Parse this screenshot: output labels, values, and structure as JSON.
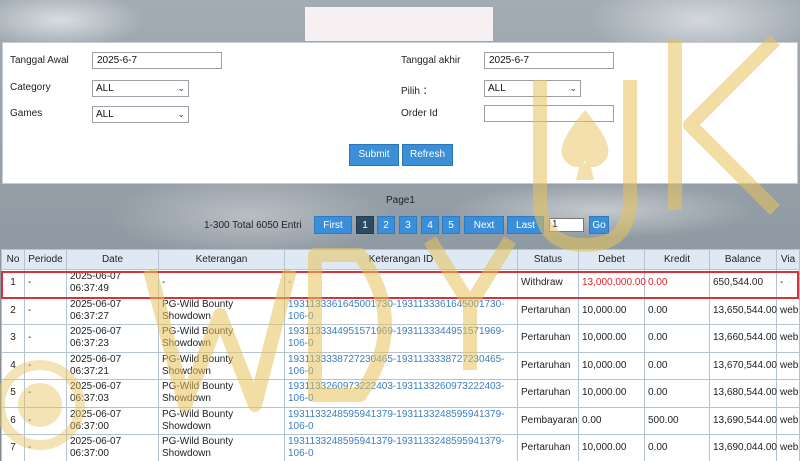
{
  "filters": {
    "tanggal_awal_label": "Tanggal Awal",
    "tanggal_awal_value": "2025-6-7",
    "tanggal_akhir_label": "Tanggal akhir",
    "tanggal_akhir_value": "2025-6-7",
    "category_label": "Category",
    "category_value": "ALL",
    "pilih_label": "Pilih ：",
    "pilih_value": "ALL",
    "games_label": "Games",
    "games_value": "ALL",
    "order_id_label": "Order Id",
    "order_id_value": "",
    "submit_label": "Submit",
    "refresh_label": "Refresh"
  },
  "pager": {
    "page_label": "Page1",
    "summary": "1-300 Total 6050 Entri",
    "first": "First",
    "pages": [
      "1",
      "2",
      "3",
      "4",
      "5"
    ],
    "next": "Next",
    "last": "Last",
    "goto_value": "1",
    "go": "Go"
  },
  "table": {
    "headers": [
      "No",
      "Periode",
      "Date",
      "Keterangan",
      "Keterangan ID",
      "Status",
      "Debet",
      "Kredit",
      "Balance",
      "Via"
    ],
    "rows": [
      {
        "no": "1",
        "periode": "-",
        "date": "2025-06-07 06:37:49",
        "keterangan": "-",
        "keterangan_id": "-",
        "status": "Withdraw",
        "debet": "13,000,000.00",
        "kredit": "0.00",
        "balance": "650,544.00",
        "via": "-"
      },
      {
        "no": "2",
        "periode": "-",
        "date": "2025-06-07 06:37:27",
        "keterangan": "PG-Wild Bounty Showdown",
        "keterangan_id": "1931133361645001730-1931133361645001730-106-0",
        "status": "Pertaruhan",
        "debet": "10,000.00",
        "kredit": "0.00",
        "balance": "13,650,544.00",
        "via": "web"
      },
      {
        "no": "3",
        "periode": "-",
        "date": "2025-06-07 06:37:23",
        "keterangan": "PG-Wild Bounty Showdown",
        "keterangan_id": "1931133344951571969-1931133344951571969-106-0",
        "status": "Pertaruhan",
        "debet": "10,000.00",
        "kredit": "0.00",
        "balance": "13,660,544.00",
        "via": "web"
      },
      {
        "no": "4",
        "periode": "-",
        "date": "2025-06-07 06:37:21",
        "keterangan": "PG-Wild Bounty Showdown",
        "keterangan_id": "1931133338727230465-1931133338727230465-106-0",
        "status": "Pertaruhan",
        "debet": "10,000.00",
        "kredit": "0.00",
        "balance": "13,670,544.00",
        "via": "web"
      },
      {
        "no": "5",
        "periode": "-",
        "date": "2025-06-07 06:37:03",
        "keterangan": "PG-Wild Bounty Showdown",
        "keterangan_id": "1931133260973222403-1931133260973222403-106-0",
        "status": "Pertaruhan",
        "debet": "10,000.00",
        "kredit": "0.00",
        "balance": "13,680,544.00",
        "via": "web"
      },
      {
        "no": "6",
        "periode": "-",
        "date": "2025-06-07 06:37:00",
        "keterangan": "PG-Wild Bounty Showdown",
        "keterangan_id": "1931133248595941379-1931133248595941379-106-0",
        "status": "Pembayaran",
        "debet": "0.00",
        "kredit": "500.00",
        "balance": "13,690,544.00",
        "via": "web"
      },
      {
        "no": "7",
        "periode": "-",
        "date": "2025-06-07 06:37:00",
        "keterangan": "PG-Wild Bounty Showdown",
        "keterangan_id": "1931133248595941379-1931133248595941379-106-0",
        "status": "Pertaruhan",
        "debet": "10,000.00",
        "kredit": "0.00",
        "balance": "13,690,044.00",
        "via": "web"
      }
    ]
  },
  "watermark": {
    "text": "WDYUK",
    "color": "#e8c25a",
    "icon": "spade-coin-icon"
  },
  "colors": {
    "accent": "#3b8fd8",
    "highlight": "#d9313b",
    "link": "#3a7fc1",
    "negative": "#e0242a",
    "header_bg": "#dfe9f4"
  }
}
